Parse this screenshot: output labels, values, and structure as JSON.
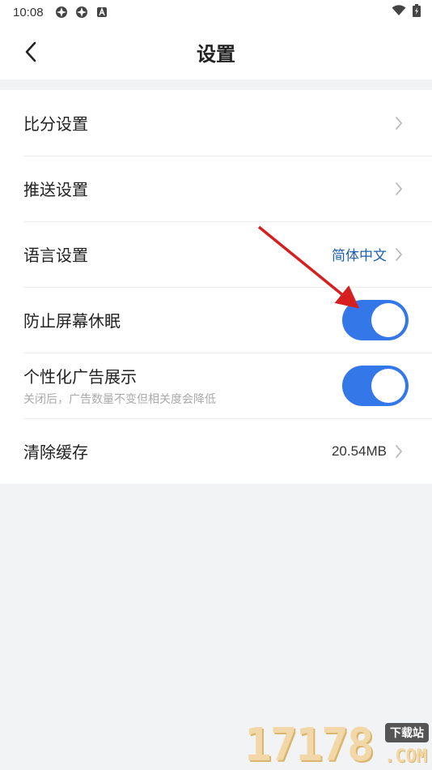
{
  "status_bar": {
    "time": "10:08",
    "left_icons": [
      "app-notification-icon",
      "app-notification-icon",
      "a-letter-icon"
    ],
    "right_icons": [
      "wifi-icon",
      "battery-charging-icon"
    ]
  },
  "header": {
    "title": "设置"
  },
  "settings": {
    "score": {
      "label": "比分设置"
    },
    "push": {
      "label": "推送设置"
    },
    "language": {
      "label": "语言设置",
      "value": "简体中文"
    },
    "screen": {
      "label": "防止屏幕休眠",
      "enabled": true
    },
    "ads": {
      "label": "个性化广告展示",
      "sub": "关闭后，广告数量不变但相关度会降低",
      "enabled": true
    },
    "cache": {
      "label": "清除缓存",
      "value": "20.54MB"
    }
  },
  "watermark": {
    "number": "17178",
    "badge": "下载站",
    "suffix": ".COM"
  },
  "colors": {
    "accent": "#3477e8",
    "value_blue": "#1f5fb0",
    "arrow": "#d62020"
  }
}
